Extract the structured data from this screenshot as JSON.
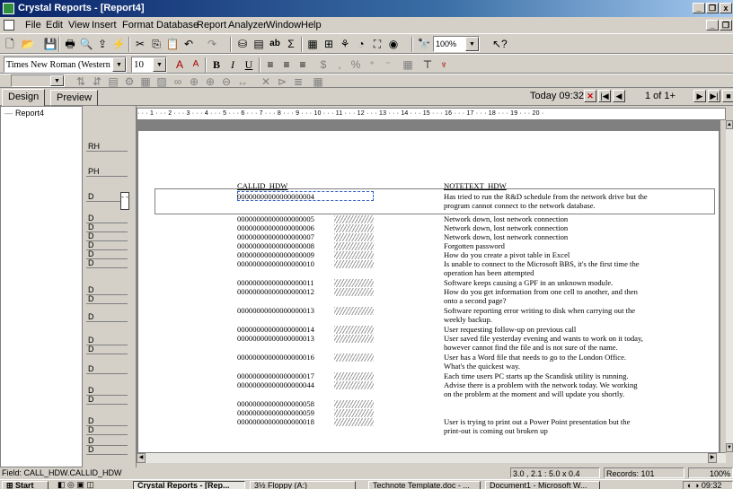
{
  "window": {
    "title": "Crystal Reports - [Report4]",
    "minimize": "_",
    "restore": "©",
    "close": "x"
  },
  "menu": [
    "File",
    "Edit",
    "View",
    "Insert",
    "Format",
    "Database",
    "Report",
    "Analyzer",
    "Window",
    "Help"
  ],
  "toolbar1": {
    "zoom": "100%"
  },
  "toolbar2": {
    "font_name": "Times New Roman (Western",
    "font_size": "10"
  },
  "tabs": {
    "design": "Design",
    "preview": "Preview"
  },
  "preview_nav": {
    "date_label": "Today 09:32",
    "page_indicator": "1 of 1+"
  },
  "tree": {
    "root": "Report4"
  },
  "sections": [
    "RH",
    "PH",
    "D",
    "D",
    "D",
    "D",
    "D",
    "D",
    "D",
    "D",
    "D",
    "D",
    "D",
    "D",
    "D",
    "D",
    "D",
    "D",
    "D",
    "D",
    "D",
    "D"
  ],
  "ruler": {
    "text": "· · · 1 · · · 2 · · · 3 · · · 4 · · · 5 · · · 6 · · · 7 · · · 8 · · · 9 · · · 10 · · · 11 · · · 12 · · · 13 · · · 14 · · · 15 · · · 16 · · · 17 · · · 18 · · · 19 · · · 20 ·"
  },
  "report": {
    "col1_header": "CALLID_HDW",
    "col2_header": "NOTETEXT_HDW",
    "rows": [
      {
        "id": "00000000000000000004",
        "text": [
          "Has tried to run the R&D schedule from the network drive but the",
          "program cannot connect to the network database."
        ]
      },
      {
        "id": "00000000000000000005",
        "text": [
          "Network down, lost network connection"
        ]
      },
      {
        "id": "00000000000000000006",
        "text": [
          "Network down, lost network connection"
        ]
      },
      {
        "id": "00000000000000000007",
        "text": [
          "Network down, lost network connection"
        ]
      },
      {
        "id": "00000000000000000008",
        "text": [
          "Forgotten password"
        ]
      },
      {
        "id": "00000000000000000009",
        "text": [
          "How do you create a pivot table in Excel"
        ]
      },
      {
        "id": "00000000000000000010",
        "text": [
          "Is unable to connect to the Microsoft BBS, it's the first time the",
          "operation has been attempted"
        ]
      },
      {
        "id": "00000000000000000011",
        "text": [
          "Software keeps causing a GPF in an unknown module."
        ]
      },
      {
        "id": "00000000000000000012",
        "text": [
          "How do you get information from one cell to another, and then",
          "onto a second page?"
        ]
      },
      {
        "id": "00000000000000000013",
        "text": [
          "Software reporting error writing to disk when carrying out the",
          "weekly backup."
        ]
      },
      {
        "id": "00000000000000000014",
        "text": [
          "User requesting follow-up on previous call"
        ]
      },
      {
        "id": "00000000000000000013",
        "text": [
          "User saved file yesterday evening and wants to work on it today,",
          "however cannot find the file and is not sure of the name."
        ]
      },
      {
        "id": "00000000000000000016",
        "text": [
          "User has a Word file that needs to go to the London Office.",
          "What's the quickest way."
        ]
      },
      {
        "id": "00000000000000000017",
        "text": [
          "Each time users PC starts up the Scandisk utility is running."
        ]
      },
      {
        "id": "00000000000000000044",
        "text": [
          "Advise there is a problem with the network today.  We working",
          "on the problem at the moment and will update you shortly."
        ]
      },
      {
        "id": "00000000000000000058",
        "text": [
          ""
        ]
      },
      {
        "id": "00000000000000000059",
        "text": [
          ""
        ]
      },
      {
        "id": "00000000000000000018",
        "text": [
          "User is trying to print out a Power Point presentation but the",
          "print-out is coming out broken up"
        ]
      }
    ]
  },
  "statusbar": {
    "field": "Field: CALL_HDW.CALLID_HDW",
    "position": "3.0 , 2.1 : 5.0 x 0.4",
    "records": "Records: 101",
    "zoom": "100%"
  },
  "taskbar": {
    "start": "Start",
    "tasks": [
      "Crystal Reports - [Rep...",
      "3½ Floppy (A:)",
      "Technote Template.doc - ...",
      "Document1 - Microsoft W..."
    ],
    "clock": "09:32"
  },
  "colors": {
    "titlebar": "#0a246a",
    "chrome": "#d4d0c8",
    "select_red": "#cc0000"
  }
}
